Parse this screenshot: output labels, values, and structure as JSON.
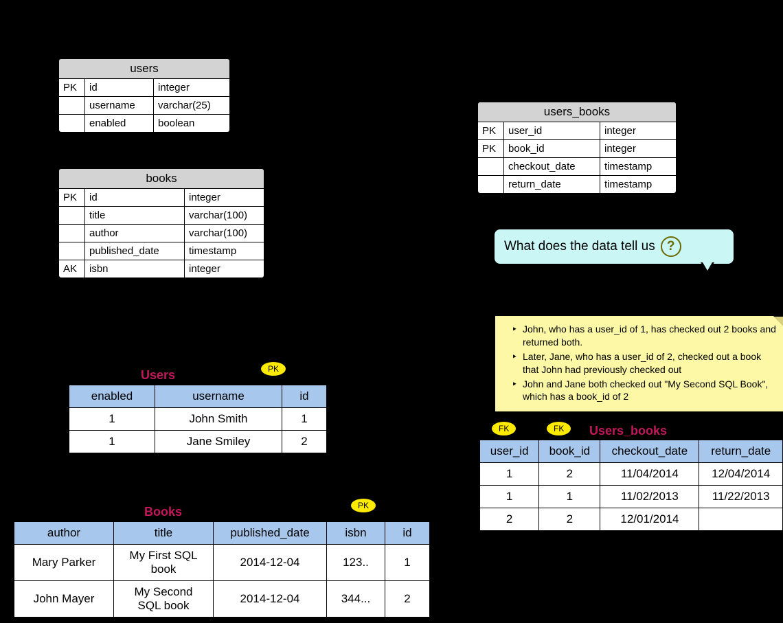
{
  "schema_users": {
    "name": "users",
    "columns": [
      {
        "key": "PK",
        "name": "id",
        "type": "integer"
      },
      {
        "key": "",
        "name": "username",
        "type": "varchar(25)"
      },
      {
        "key": "",
        "name": "enabled",
        "type": "boolean"
      }
    ]
  },
  "schema_books": {
    "name": "books",
    "columns": [
      {
        "key": "PK",
        "name": "id",
        "type": "integer"
      },
      {
        "key": "",
        "name": "title",
        "type": "varchar(100)"
      },
      {
        "key": "",
        "name": "author",
        "type": "varchar(100)"
      },
      {
        "key": "",
        "name": "published_date",
        "type": "timestamp"
      },
      {
        "key": "AK",
        "name": "isbn",
        "type": "integer"
      }
    ]
  },
  "schema_users_books": {
    "name": "users_books",
    "columns": [
      {
        "key": "PK",
        "name": "user_id",
        "type": "integer"
      },
      {
        "key": "PK",
        "name": "book_id",
        "type": "integer"
      },
      {
        "key": "",
        "name": "checkout_date",
        "type": "timestamp"
      },
      {
        "key": "",
        "name": "return_date",
        "type": "timestamp"
      }
    ]
  },
  "badges": {
    "pk": "PK",
    "fk": "FK"
  },
  "callout_text": "What does the data tell us",
  "note_items": [
    "John, who has a user_id of 1, has checked out 2 books and returned both.",
    "Later, Jane, who has a user_id of 2, checked out a book that John had previously checked out",
    "John and Jane both checked out \"My Second SQL Book\", which has a book_id of 2"
  ],
  "data_users": {
    "title": "Users",
    "headers": [
      "enabled",
      "username",
      "id"
    ],
    "rows": [
      [
        "1",
        "John Smith",
        "1"
      ],
      [
        "1",
        "Jane Smiley",
        "2"
      ]
    ]
  },
  "data_books": {
    "title": "Books",
    "headers": [
      "author",
      "title",
      "published_date",
      "isbn",
      "id"
    ],
    "rows": [
      [
        "Mary Parker",
        "My First SQL book",
        "2014-12-04",
        "123..",
        "1"
      ],
      [
        "John Mayer",
        "My Second SQL book",
        "2014-12-04",
        "344...",
        "2"
      ]
    ]
  },
  "data_users_books": {
    "title": "Users_books",
    "headers": [
      "user_id",
      "book_id",
      "checkout_date",
      "return_date"
    ],
    "rows": [
      [
        "1",
        "2",
        "11/04/2014",
        "12/04/2014"
      ],
      [
        "1",
        "1",
        "11/02/2013",
        "11/22/2013"
      ],
      [
        "2",
        "2",
        "12/01/2014",
        ""
      ]
    ]
  },
  "chart_data": {
    "type": "table",
    "entities": [
      {
        "name": "users",
        "primary_key": [
          "id"
        ],
        "columns": [
          {
            "name": "id",
            "type": "integer"
          },
          {
            "name": "username",
            "type": "varchar(25)"
          },
          {
            "name": "enabled",
            "type": "boolean"
          }
        ]
      },
      {
        "name": "books",
        "primary_key": [
          "id"
        ],
        "alternate_key": [
          "isbn"
        ],
        "columns": [
          {
            "name": "id",
            "type": "integer"
          },
          {
            "name": "title",
            "type": "varchar(100)"
          },
          {
            "name": "author",
            "type": "varchar(100)"
          },
          {
            "name": "published_date",
            "type": "timestamp"
          },
          {
            "name": "isbn",
            "type": "integer"
          }
        ]
      },
      {
        "name": "users_books",
        "primary_key": [
          "user_id",
          "book_id"
        ],
        "foreign_keys": [
          {
            "column": "user_id",
            "references": "users.id"
          },
          {
            "column": "book_id",
            "references": "books.id"
          }
        ],
        "columns": [
          {
            "name": "user_id",
            "type": "integer"
          },
          {
            "name": "book_id",
            "type": "integer"
          },
          {
            "name": "checkout_date",
            "type": "timestamp"
          },
          {
            "name": "return_date",
            "type": "timestamp"
          }
        ]
      }
    ],
    "sample_data": {
      "users": [
        {
          "id": 1,
          "username": "John Smith",
          "enabled": 1
        },
        {
          "id": 2,
          "username": "Jane Smiley",
          "enabled": 1
        }
      ],
      "books": [
        {
          "id": 1,
          "title": "My First SQL book",
          "author": "Mary Parker",
          "published_date": "2014-12-04",
          "isbn": "123.."
        },
        {
          "id": 2,
          "title": "My Second SQL book",
          "author": "John Mayer",
          "published_date": "2014-12-04",
          "isbn": "344..."
        }
      ],
      "users_books": [
        {
          "user_id": 1,
          "book_id": 2,
          "checkout_date": "11/04/2014",
          "return_date": "12/04/2014"
        },
        {
          "user_id": 1,
          "book_id": 1,
          "checkout_date": "11/02/2013",
          "return_date": "11/22/2013"
        },
        {
          "user_id": 2,
          "book_id": 2,
          "checkout_date": "12/01/2014",
          "return_date": null
        }
      ]
    }
  }
}
